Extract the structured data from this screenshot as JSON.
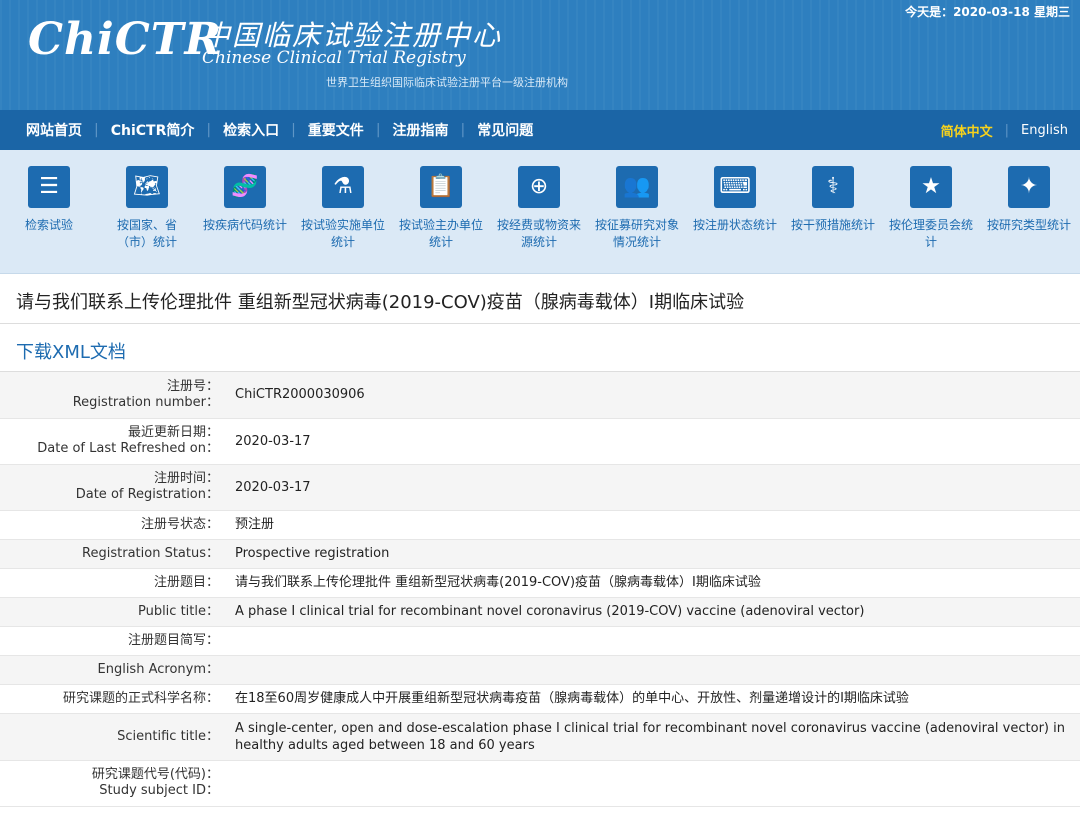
{
  "header": {
    "logo": "ChiCTR",
    "title_cn": "中国临床试验注册中心",
    "title_en": "Chinese Clinical Trial Registry",
    "subtitle": "世界卫生组织国际临床试验注册平台一级注册机构",
    "date": "今天是：2020-03-18 星期三"
  },
  "nav": {
    "items": [
      "网站首页",
      "ChiCTR简介",
      "检索入口",
      "重要文件",
      "注册指南",
      "常见问题"
    ],
    "lang_cn": "简体中文",
    "lang_en": "English"
  },
  "stats": [
    {
      "icon": "list-icon",
      "glyph": "☰",
      "label": "检索试验"
    },
    {
      "icon": "world-map-icon",
      "glyph": "🗺",
      "label": "按国家、省（市）统计"
    },
    {
      "icon": "dna-icon",
      "glyph": "🧬",
      "label": "按疾病代码统计"
    },
    {
      "icon": "flask-icon",
      "glyph": "⚗",
      "label": "按试验实施单位统计"
    },
    {
      "icon": "clipboard-icon",
      "glyph": "📋",
      "label": "按试验主办单位统计"
    },
    {
      "icon": "medkit-icon",
      "glyph": "⊕",
      "label": "按经费或物资来源统计"
    },
    {
      "icon": "people-icon",
      "glyph": "👥",
      "label": "按征募研究对象情况统计"
    },
    {
      "icon": "keyboard-icon",
      "glyph": "⌨",
      "label": "按注册状态统计"
    },
    {
      "icon": "doctor-icon",
      "glyph": "⚕",
      "label": "按干预措施统计"
    },
    {
      "icon": "star-icon",
      "glyph": "★",
      "label": "按伦理委员会统计"
    },
    {
      "icon": "sparkle-icon",
      "glyph": "✦",
      "label": "按研究类型统计"
    }
  ],
  "page_title": "请与我们联系上传伦理批件 重组新型冠状病毒(2019-COV)疫苗（腺病毒载体）I期临床试验",
  "download_xml": "下载XML文档",
  "rows": [
    {
      "label": "注册号：",
      "label_en": "Registration number：",
      "value": "ChiCTR2000030906"
    },
    {
      "label": "最近更新日期：",
      "label_en": "Date of Last Refreshed on：",
      "value": "2020-03-17"
    },
    {
      "label": "注册时间：",
      "label_en": "Date of Registration：",
      "value": "2020-03-17"
    },
    {
      "label": "注册号状态：",
      "label_en": "",
      "value": "预注册"
    },
    {
      "label": "Registration Status：",
      "label_en": "",
      "value": "Prospective registration"
    },
    {
      "label": "注册题目：",
      "label_en": "",
      "value": "请与我们联系上传伦理批件 重组新型冠状病毒(2019-COV)疫苗（腺病毒载体）I期临床试验"
    },
    {
      "label": "Public title：",
      "label_en": "",
      "value": "A phase I clinical trial for recombinant novel coronavirus (2019-COV) vaccine (adenoviral vector)"
    },
    {
      "label": "注册题目简写：",
      "label_en": "",
      "value": ""
    },
    {
      "label": "English Acronym：",
      "label_en": "",
      "value": ""
    },
    {
      "label": "研究课题的正式科学名称：",
      "label_en": "",
      "value": "在18至60周岁健康成人中开展重组新型冠状病毒疫苗（腺病毒载体）的单中心、开放性、剂量递增设计的I期临床试验"
    },
    {
      "label": "Scientific title：",
      "label_en": "",
      "value": "A single-center, open and dose-escalation phase I clinical trial for recombinant novel coronavirus vaccine (adenoviral vector) in healthy adults aged between 18 and 60 years"
    },
    {
      "label": "研究课题代号(代码)：",
      "label_en": "Study subject ID：",
      "value": ""
    }
  ]
}
